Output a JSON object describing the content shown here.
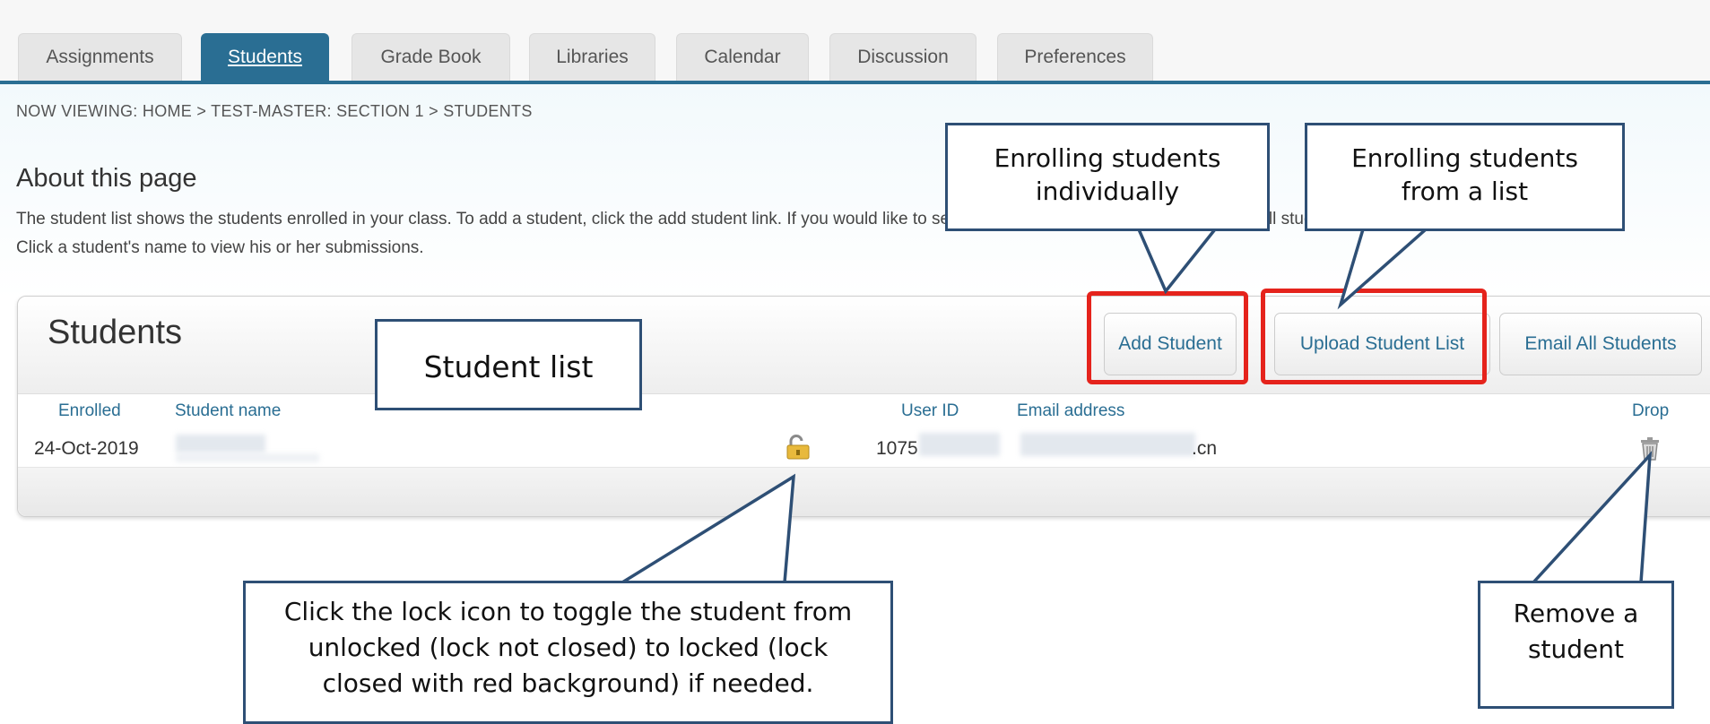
{
  "tabs": [
    {
      "label": "Assignments",
      "active": false
    },
    {
      "label": "Students",
      "active": true
    },
    {
      "label": "Grade Book",
      "active": false
    },
    {
      "label": "Libraries",
      "active": false
    },
    {
      "label": "Calendar",
      "active": false
    },
    {
      "label": "Discussion",
      "active": false
    },
    {
      "label": "Preferences",
      "active": false
    }
  ],
  "breadcrumb": "NOW VIEWING: HOME > TEST-MASTER: SECTION 1 > STUDENTS",
  "about": {
    "title": "About this page",
    "text_line1": "The student list shows the students enrolled in your class. To add a student, click the add student link. If you would like to send an email to your class, click the email all students link.",
    "text_line2": "Click a student's name to view his or her submissions."
  },
  "panel": {
    "title": "Students",
    "buttons": {
      "add": "Add Student",
      "upload": "Upload Student List",
      "email": "Email All Students"
    },
    "columns": {
      "enrolled": "Enrolled",
      "name": "Student name",
      "user_id": "User ID",
      "email": "Email address",
      "drop": "Drop"
    },
    "rows": [
      {
        "enrolled": "24-Oct-2019",
        "user_id": "1075",
        "email_suffix": ".cn"
      }
    ]
  },
  "callouts": {
    "individually": "Enrolling students individually",
    "from_list": "Enrolling students from a list",
    "student_list": "Student list",
    "lock_line1": "Click the lock icon to toggle the student from",
    "lock_line2": "unlocked (lock not closed) to locked (lock",
    "lock_line3": "closed with red background) if needed.",
    "remove_line1": "Remove a",
    "remove_line2": "student"
  },
  "colors": {
    "accent": "#2a6e93",
    "highlight": "#e5231c",
    "callout_border": "#2e4f75"
  }
}
